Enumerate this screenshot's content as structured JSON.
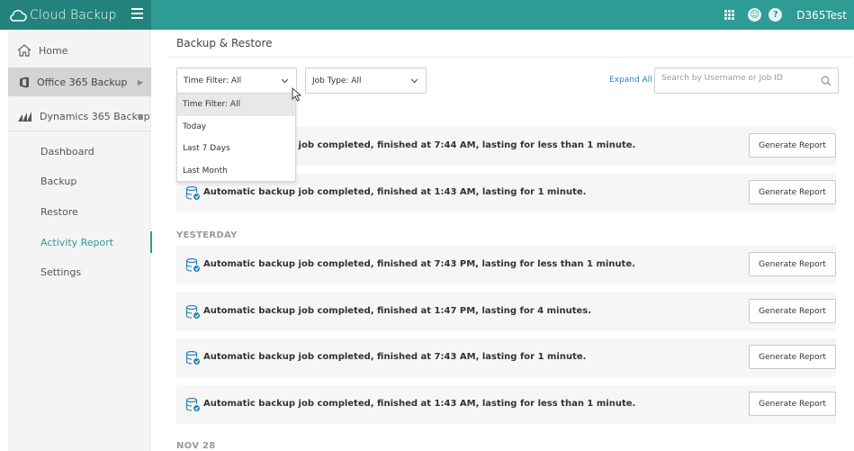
{
  "app": {
    "brand_name": "Cloud Backup",
    "user_name": "D365Test",
    "accent": "#2e9b94"
  },
  "sidebar": {
    "items": [
      {
        "label": "Home",
        "icon": "home-icon"
      },
      {
        "label": "Office 365 Backup",
        "icon": "office-icon"
      },
      {
        "label": "Dynamics 365 Backup",
        "icon": "dynamics-icon"
      }
    ],
    "sub_items": [
      {
        "label": "Dashboard"
      },
      {
        "label": "Backup"
      },
      {
        "label": "Restore"
      },
      {
        "label": "Activity Report",
        "active": true
      },
      {
        "label": "Settings"
      }
    ]
  },
  "main": {
    "page_title": "Backup & Restore",
    "filters": {
      "time_filter": "Time Filter: All",
      "job_type": "Job Type: All",
      "expand_all": "Expand All",
      "search_placeholder": "Search by Username or Job ID"
    },
    "time_filter_options": [
      "Time Filter: All",
      "Today",
      "Last 7 Days",
      "Last Month"
    ],
    "button_label": "Generate Report",
    "sections": [
      {
        "label": "",
        "rows": [
          {
            "text": "Automatic backup job completed, finished at 7:44 AM, lasting for less than 1 minute."
          },
          {
            "text": "Automatic backup job completed, finished at 1:43 AM, lasting for 1 minute."
          }
        ]
      },
      {
        "label": "YESTERDAY",
        "rows": [
          {
            "text": "Automatic backup job completed, finished at 7:43 PM, lasting for less than 1 minute."
          },
          {
            "text": "Automatic backup job completed, finished at 1:47 PM, lasting for 4 minutes."
          },
          {
            "text": "Automatic backup job completed, finished at 7:43 AM, lasting for 1 minute."
          },
          {
            "text": "Automatic backup job completed, finished at 1:43 AM, lasting for less than 1 minute."
          }
        ]
      },
      {
        "label": "NOV 28",
        "rows": []
      }
    ]
  }
}
